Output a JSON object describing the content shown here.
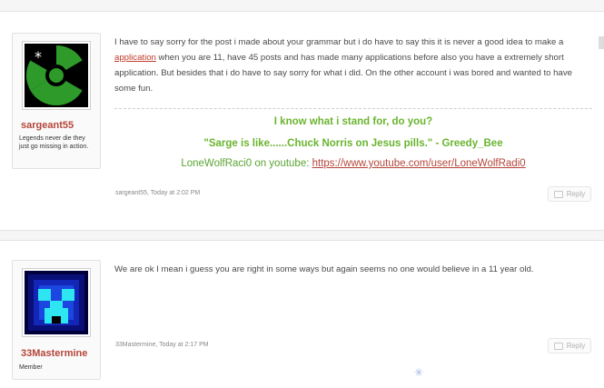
{
  "posts": [
    {
      "author": {
        "username": "sargeant55",
        "title": "Legends never die they just go missing in action.",
        "avatar_icon": "radiation-icon"
      },
      "message": {
        "text_before_link": "I have to say sorry for the post i made about your grammar but i do have to say this it is never a good idea to make a",
        "link_text": "application",
        "text_after_link": "when you are 11, have 45 posts and has made many applications before also you have a extremely short application. But besides that i do have to say sorry for what i did. On the other account i was bored and wanted to have some fun."
      },
      "signature": {
        "line1": "I know what i stand for, do you?",
        "line2": "\"Sarge is like......Chuck Norris on Jesus pills.\" - Greedy_Bee",
        "line3_prefix": "LoneWolfRaci0 on youtube:",
        "line3_link": "https://www.youtube.com/user/LoneWolfRadi0"
      },
      "meta": "sargeant55, Today at 2:02 PM",
      "reply_label": "Reply"
    },
    {
      "author": {
        "username": "33Mastermine",
        "title": "Member",
        "avatar_icon": "creeper-face-icon"
      },
      "message": {
        "text": "We are ok I mean i guess you are right in some ways but again seems no one would believe in a 11 year old."
      },
      "meta": "33Mastermine, Today at 2:17 PM",
      "reply_label": "Reply"
    }
  ],
  "colors": {
    "username": "#b5463a",
    "signature_green": "#6ab42f",
    "link_red": "#c0392b"
  }
}
